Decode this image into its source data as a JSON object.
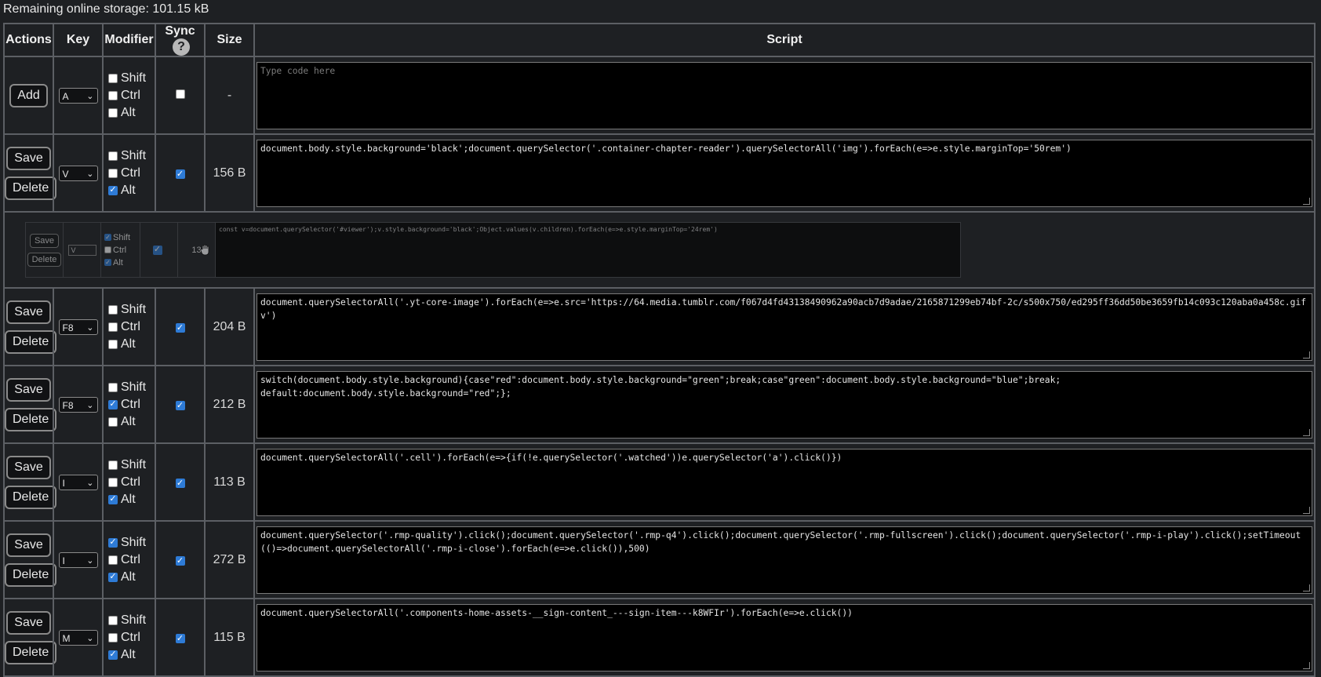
{
  "storage_text": "Remaining online storage: 101.15 kB",
  "headers": {
    "actions": "Actions",
    "key": "Key",
    "modifier": "Modifier",
    "sync": "Sync",
    "help": "?",
    "size": "Size",
    "script": "Script"
  },
  "modifier_labels": {
    "shift": "Shift",
    "ctrl": "Ctrl",
    "alt": "Alt"
  },
  "new_row": {
    "button": "Add",
    "key": "A",
    "size": "-",
    "placeholder": "Type code here"
  },
  "buttons": {
    "save": "Save",
    "delete": "Delete"
  },
  "rows": [
    {
      "key": "V",
      "shift": false,
      "ctrl": false,
      "alt": true,
      "sync": true,
      "size": "156 B",
      "script": "document.body.style.background='black';document.querySelector('.container-chapter-reader').querySelectorAll('img').forEach(e=>e.style.marginTop='50rem')"
    },
    {
      "key": "F8",
      "shift": false,
      "ctrl": false,
      "alt": false,
      "sync": true,
      "size": "204 B",
      "script": "document.querySelectorAll('.yt-core-image').forEach(e=>e.src='https://64.media.tumblr.com/f067d4fd43138490962a90acb7d9adae/2165871299eb74bf-2c/s500x750/ed295ff36dd50be3659fb14c093c120aba0a458c.gifv')"
    },
    {
      "key": "F8",
      "shift": false,
      "ctrl": true,
      "alt": false,
      "sync": true,
      "size": "212 B",
      "script": "switch(document.body.style.background){case\"red\":document.body.style.background=\"green\";break;case\"green\":document.body.style.background=\"blue\";break;\ndefault:document.body.style.background=\"red\";};"
    },
    {
      "key": "I",
      "shift": false,
      "ctrl": false,
      "alt": true,
      "sync": true,
      "size": "113 B",
      "script": "document.querySelectorAll('.cell').forEach(e=>{if(!e.querySelector('.watched'))e.querySelector('a').click()})"
    },
    {
      "key": "I",
      "shift": true,
      "ctrl": false,
      "alt": true,
      "sync": true,
      "size": "272 B",
      "script": "document.querySelector('.rmp-quality').click();document.querySelector('.rmp-q4').click();document.querySelector('.rmp-fullscreen').click();document.querySelector('.rmp-i-play').click();setTimeout(()=>document.querySelectorAll('.rmp-i-close').forEach(e=>e.click()),500)"
    },
    {
      "key": "M",
      "shift": false,
      "ctrl": false,
      "alt": true,
      "sync": true,
      "size": "115 B",
      "script": "document.querySelectorAll('.components-home-assets-__sign-content_---sign-item---k8WFIr').forEach(e=>e.click())"
    }
  ],
  "dragged_row": {
    "key": "V",
    "shift": true,
    "ctrl": false,
    "alt": true,
    "sync": true,
    "size": "13",
    "script": "const v=document.querySelector('#viewer');v.style.background='black';Object.values(v.children).forEach(e=>e.style.marginTop='24rem')"
  }
}
